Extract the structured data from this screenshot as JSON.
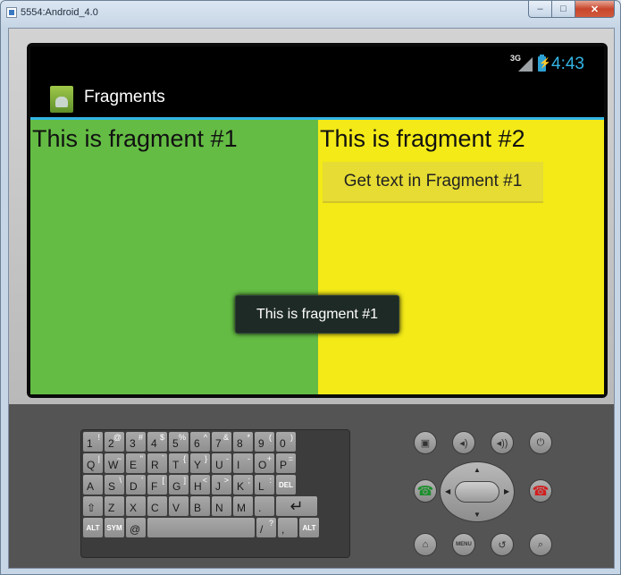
{
  "window": {
    "title": "5554:Android_4.0"
  },
  "status_bar": {
    "network": "3G",
    "clock": "4:43"
  },
  "action_bar": {
    "title": "Fragments",
    "icon": "app-launcher-icon"
  },
  "fragment1": {
    "text": "This is fragment #1",
    "bg": "#64bc44"
  },
  "fragment2": {
    "text": "This is fragment #2",
    "button_label": "Get text in Fragment #1",
    "bg": "#f3ea17"
  },
  "toast": {
    "text": "This is fragment #1"
  },
  "colors": {
    "accent": "#33b5e5"
  },
  "keyboard": {
    "row1": [
      [
        "1",
        "!"
      ],
      [
        "2",
        "@"
      ],
      [
        "3",
        "#"
      ],
      [
        "4",
        "$"
      ],
      [
        "5",
        "%"
      ],
      [
        "6",
        "^"
      ],
      [
        "7",
        "&"
      ],
      [
        "8",
        "*"
      ],
      [
        "9",
        "("
      ],
      [
        "0",
        ")"
      ]
    ],
    "row2": [
      [
        "Q",
        "|"
      ],
      [
        "W",
        "~"
      ],
      [
        "E",
        "\""
      ],
      [
        "R",
        "`"
      ],
      [
        "T",
        "{"
      ],
      [
        "Y",
        "}"
      ],
      [
        "U",
        "-"
      ],
      [
        "I",
        "-"
      ],
      [
        "O",
        "+"
      ],
      [
        "P",
        "="
      ]
    ],
    "row3": [
      [
        "A",
        ""
      ],
      [
        "S",
        "\\"
      ],
      [
        "D",
        "'"
      ],
      [
        "F",
        "["
      ],
      [
        "G",
        "]"
      ],
      [
        "H",
        "<"
      ],
      [
        "J",
        ">"
      ],
      [
        "K",
        ";"
      ],
      [
        "L",
        ":"
      ],
      [
        "DEL",
        ""
      ]
    ],
    "row4": [
      [
        "⇧",
        ""
      ],
      [
        "Z",
        ""
      ],
      [
        "X",
        ""
      ],
      [
        "C",
        ""
      ],
      [
        "V",
        ""
      ],
      [
        "B",
        ""
      ],
      [
        "N",
        ""
      ],
      [
        "M",
        ""
      ],
      [
        ".",
        ""
      ],
      [
        "↵",
        ""
      ]
    ],
    "row5": [
      [
        "ALT",
        ""
      ],
      [
        "SYM",
        ""
      ],
      [
        "@",
        ""
      ],
      [
        "",
        ""
      ],
      [
        "/",
        "?"
      ],
      [
        ",",
        ""
      ],
      [
        "ALT",
        ""
      ]
    ]
  },
  "hardware_buttons": {
    "camera": "camera-icon",
    "volume_down": "volume-down-icon",
    "volume_up": "volume-up-icon",
    "power": "power-icon",
    "call": "call-icon",
    "end_call": "end-call-icon",
    "home": "home-icon",
    "menu": "MENU",
    "back": "back-icon",
    "search": "search-icon"
  }
}
